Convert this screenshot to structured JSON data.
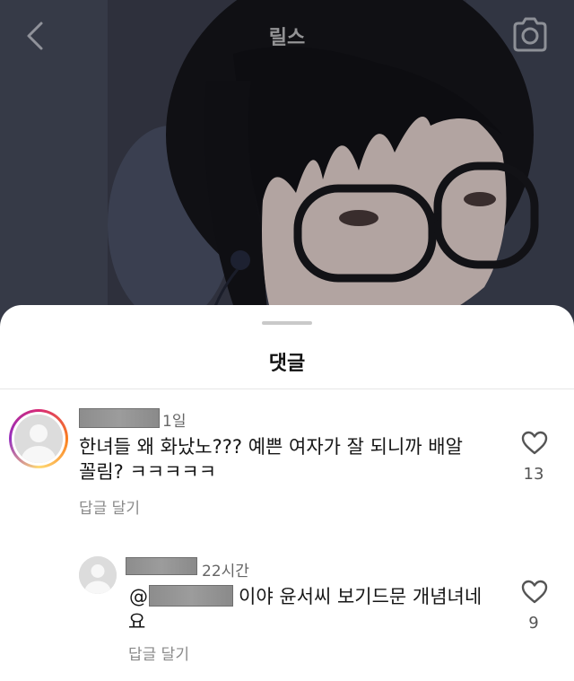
{
  "header": {
    "title": "릴스",
    "back_icon": "chevron-left-icon",
    "camera_icon": "camera-icon"
  },
  "comments_sheet": {
    "title": "댓글"
  },
  "comments": [
    {
      "time": "1일",
      "text_line1": "한녀들 왜 화났노??? 예쁜 여자가 잘 되니까 배알",
      "text_line2": "꼴림? ㅋㅋㅋㅋㅋ",
      "reply_label": "답글 달기",
      "likes": "13",
      "avatar_ring": true
    },
    {
      "time": "22시간",
      "mention_prefix": "@",
      "text_line1": "이야 윤서씨 보기드문 개념녀네",
      "text_line2": "요",
      "reply_label": "답글 달기",
      "likes": "9"
    }
  ],
  "colors": {
    "ring_gradient": [
      "#d62976",
      "#fa7e1e",
      "#feda75",
      "#962fbf"
    ],
    "secondary_text": "#8a8a8a"
  }
}
